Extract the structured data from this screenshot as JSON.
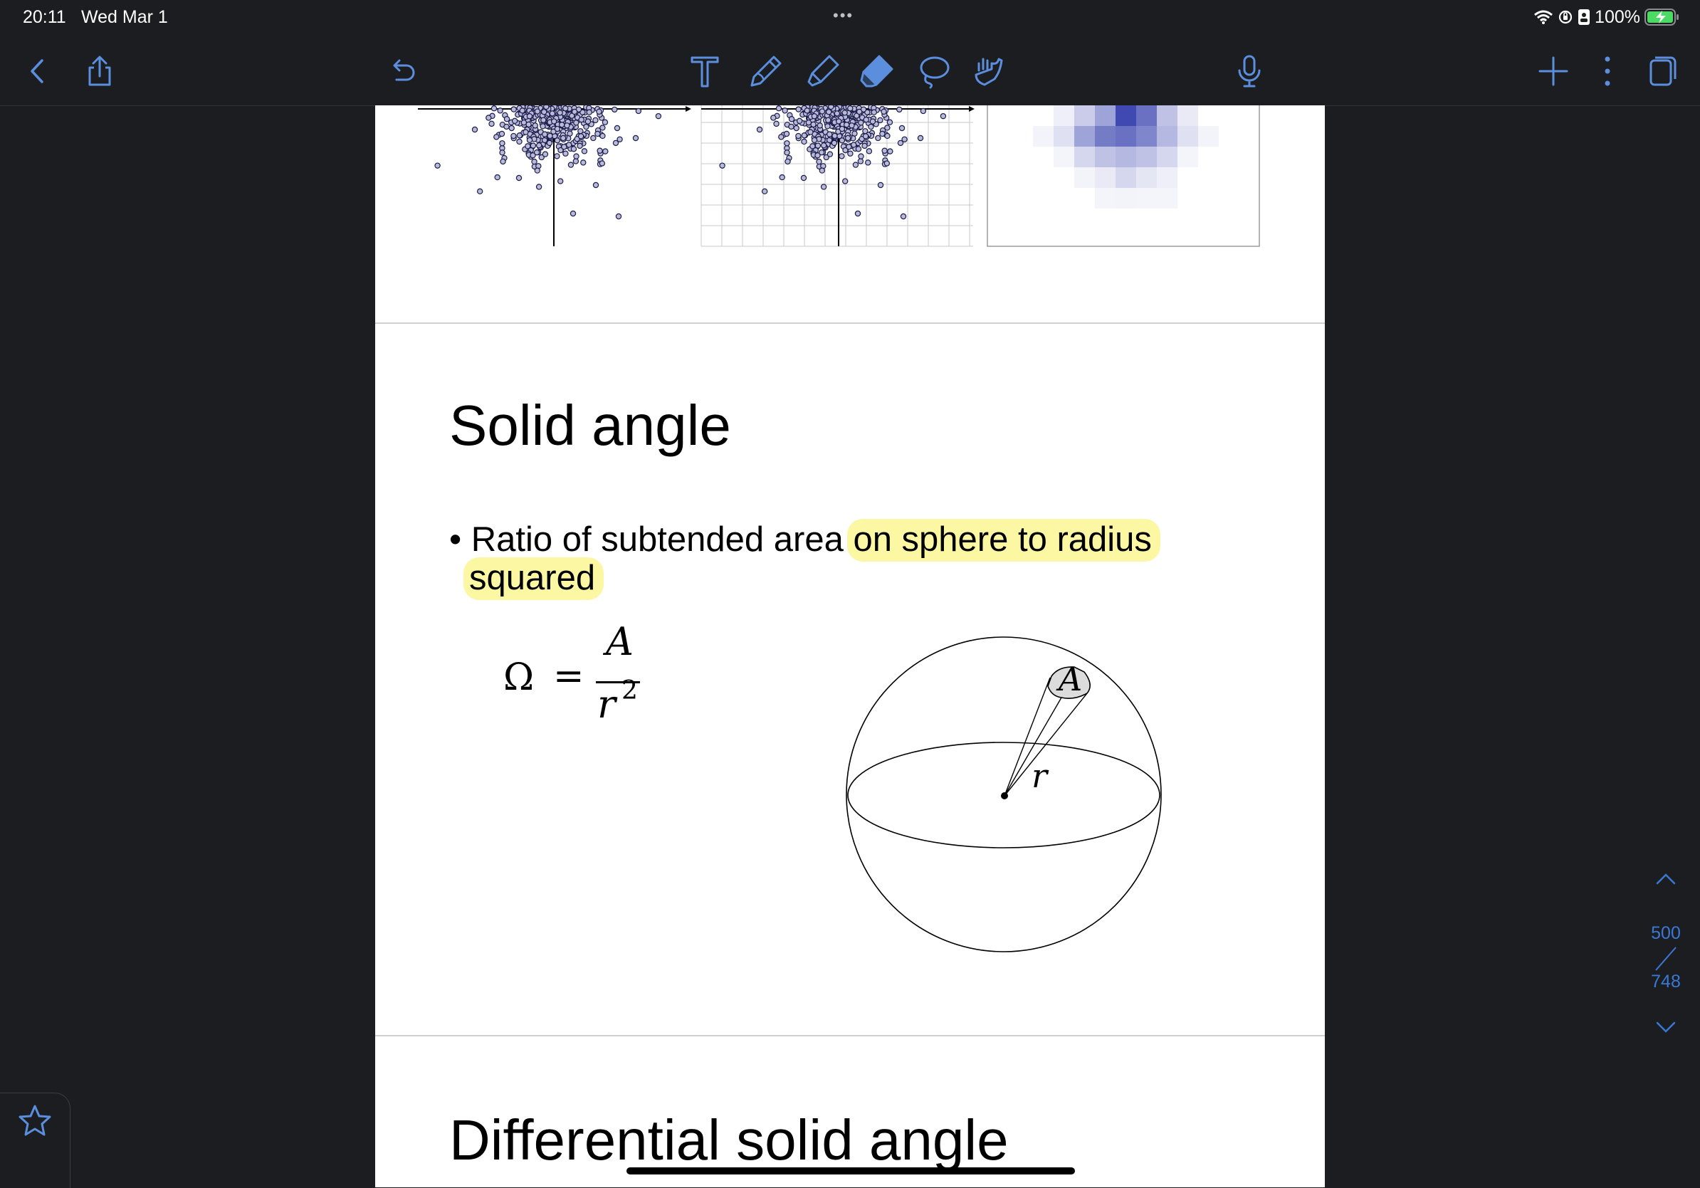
{
  "status_bar": {
    "time": "20:11",
    "date": "Wed Mar 1",
    "battery_percent": "100%",
    "multitask_dots": "•••"
  },
  "toolbar": {
    "left": [
      "back-icon",
      "share-icon",
      "undo-icon"
    ],
    "tools": [
      "text-tool-icon",
      "pen-tool-icon",
      "highlighter-tool-icon",
      "eraser-tool-icon",
      "lasso-tool-icon",
      "shape-tool-icon"
    ],
    "right": [
      "microphone-icon",
      "add-page-icon",
      "more-options-icon",
      "pages-overview-icon"
    ],
    "accent_color": "#5b8fde"
  },
  "document": {
    "slide_title": "Solid angle",
    "bullet_line1_plain": "Ratio of subtended area ",
    "bullet_line1_highlighted": "on sphere to radius",
    "bullet_line2_highlighted": "squared",
    "highlight_color": "#fbf7a3",
    "formula": {
      "lhs": "Ω",
      "equals": "=",
      "numerator": "A",
      "denominator": "r",
      "exponent": "2"
    },
    "figure_labels": {
      "area": "A",
      "radius": "r"
    },
    "next_slide_title": "Differential solid angle"
  },
  "page_scrubber": {
    "current_page": "500",
    "total_pages": "748"
  },
  "colors": {
    "background": "#1c1d20",
    "page": "#ffffff",
    "accent": "#3a78d4"
  }
}
